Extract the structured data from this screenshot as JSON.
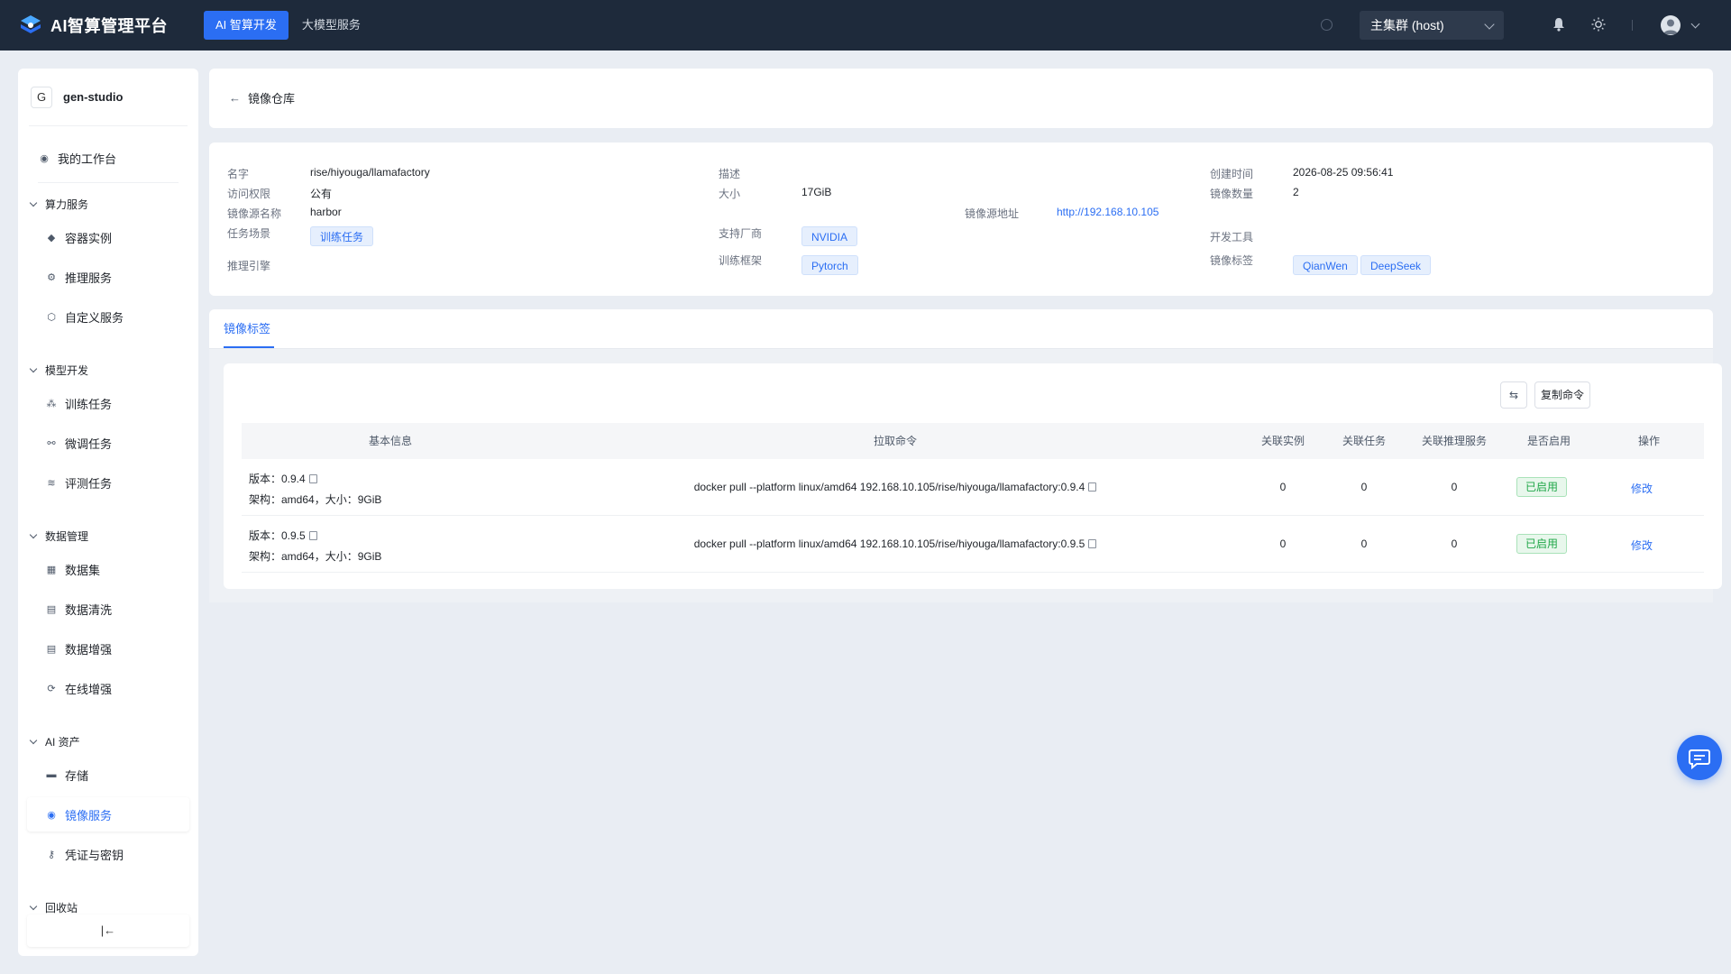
{
  "app": {
    "title": "AI智算管理平台"
  },
  "top_nav": {
    "tabs": [
      {
        "label": "AI 智算开发"
      },
      {
        "label": "大模型服务"
      }
    ]
  },
  "cluster": {
    "selected": "主集群 (host)"
  },
  "sidebar": {
    "project_initial": "G",
    "project_name": "gen-studio",
    "workspace": "我的工作台",
    "groups": {
      "compute": "算力服务",
      "model": "模型开发",
      "data": "数据管理",
      "assets": "AI 资产",
      "recycle": "回收站"
    },
    "items": {
      "container": "容器实例",
      "inference": "推理服务",
      "custom": "自定义服务",
      "training": "训练任务",
      "finetune": "微调任务",
      "evaluate": "评测任务",
      "dataset": "数据集",
      "cleaning": "数据清洗",
      "augment": "数据增强",
      "online_augment": "在线增强",
      "storage": "存储",
      "image_service": "镜像服务",
      "credentials": "凭证与密钥"
    },
    "collapse_symbol": "|←"
  },
  "breadcrumb": {
    "back_label": "镜像仓库"
  },
  "detail": {
    "name_label": "名字",
    "name_value": "rise/hiyouga/llamafactory",
    "access_label": "访问权限",
    "access_value": "公有",
    "source_label": "镜像源名称",
    "source_value": "harbor",
    "scene_label": "任务场景",
    "scene_chip": "训练任务",
    "engine_label": "推理引擎",
    "desc_label": "描述",
    "size_label": "大小",
    "size_value": "17GiB",
    "vendor_label": "支持厂商",
    "vendor_chip": "NVIDIA",
    "framework_label": "训练框架",
    "framework_chip": "Pytorch",
    "addr_label": "镜像源地址",
    "addr_value": "http://192.168.10.105",
    "created_label": "创建时间",
    "created_value": "2026-08-25 09:56:41",
    "count_label": "镜像数量",
    "count_value": "2",
    "devtool_label": "开发工具",
    "tags_label": "镜像标签",
    "tag1": "QianWen",
    "tag2": "DeepSeek"
  },
  "tabs": {
    "active": "镜像标签"
  },
  "toolbar": {
    "copy_cmd": "复制命令"
  },
  "table": {
    "headers": {
      "basic": "基本信息",
      "pull": "拉取命令",
      "instances": "关联实例",
      "tasks": "关联任务",
      "inference": "关联推理服务",
      "enabled": "是否启用",
      "ops": "操作"
    },
    "rows": [
      {
        "version": "版本：0.9.4",
        "arch": "架构：amd64，大小：9GiB",
        "cmd": "docker pull --platform linux/amd64 192.168.10.105/rise/hiyouga/llamafactory:0.9.4",
        "instances": "0",
        "tasks": "0",
        "inference": "0",
        "status": "已启用",
        "action": "修改"
      },
      {
        "version": "版本：0.9.5",
        "arch": "架构：amd64，大小：9GiB",
        "cmd": "docker pull --platform linux/amd64 192.168.10.105/rise/hiyouga/llamafactory:0.9.5",
        "instances": "0",
        "tasks": "0",
        "inference": "0",
        "status": "已启用",
        "action": "修改"
      }
    ]
  },
  "colors": {
    "accent": "#2b6ef3",
    "topbar": "#1e2a3b",
    "success": "#1fa748"
  }
}
